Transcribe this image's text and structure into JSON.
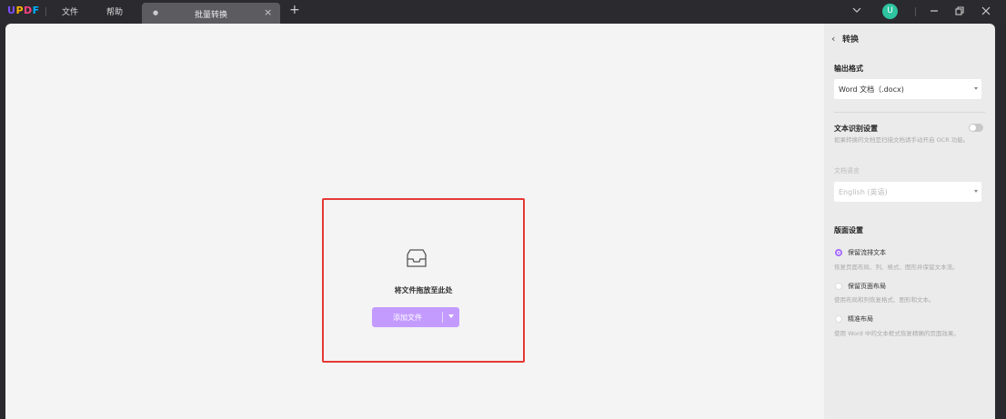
{
  "titlebar": {
    "logo": [
      "U",
      "P",
      "D",
      "F"
    ],
    "menu": [
      "文件",
      "帮助"
    ],
    "tab_label": "批量转换",
    "avatar_initial": "U"
  },
  "main": {
    "drop_text": "将文件拖放至此处",
    "add_button": "添加文件"
  },
  "sidebar": {
    "title": "转换",
    "output_format_label": "输出格式",
    "output_format_value": "Word 文档（.docx)",
    "ocr_label": "文本识别设置",
    "ocr_desc": "如果转换的文档是扫描文档请手动开启 OCR 功能。",
    "doc_lang_label": "文档语言",
    "doc_lang_value": "English (英语)",
    "layout_label": "版面设置",
    "options": [
      {
        "label": "保留流排文本",
        "desc": "恢复页面布局、列、格式、图形并保留文本流。",
        "selected": true
      },
      {
        "label": "保留页面布局",
        "desc": "使用布局和列恢复格式、图形和文本。",
        "selected": false
      },
      {
        "label": "精准布局",
        "desc": "使用 Word 中的文本框式恢复精确的页面效果。",
        "selected": false
      }
    ]
  },
  "colors": {
    "accent": "#a46bff",
    "button": "#c39bff",
    "highlight_border": "#e53935",
    "titlebar": "#2b2b2f"
  }
}
